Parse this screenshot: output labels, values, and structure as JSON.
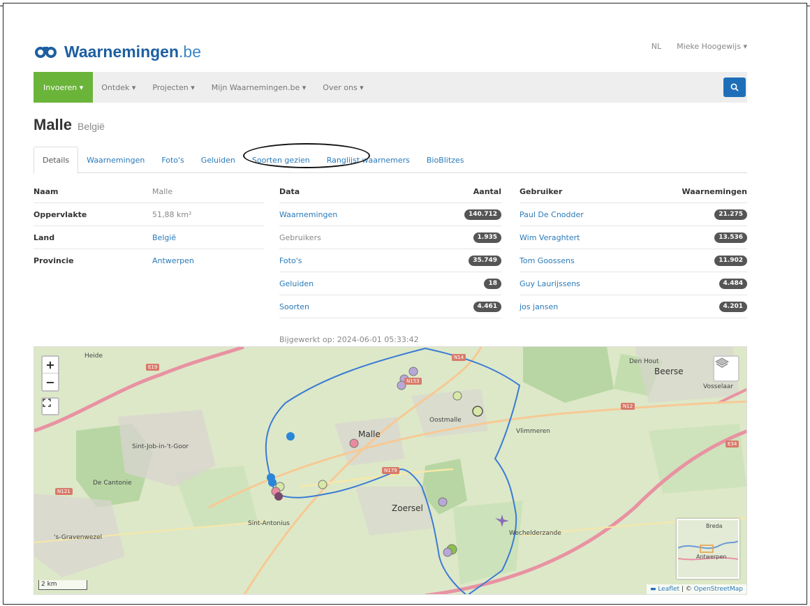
{
  "brand": {
    "name": "Waarnemingen",
    "tld": ".be"
  },
  "header": {
    "language": "NL",
    "user": "Mieke Hoogewijs ▾"
  },
  "nav": {
    "items": [
      "Invoeren ▾",
      "Ontdek ▾",
      "Projecten ▾",
      "Mijn Waarnemingen.be ▾",
      "Over ons ▾"
    ]
  },
  "title": {
    "main": "Malle",
    "sub": "België"
  },
  "tabs": [
    "Details",
    "Waarnemingen",
    "Foto's",
    "Geluiden",
    "Soorten gezien",
    "Ranglijst waarnemers",
    "BioBlitzes"
  ],
  "details": {
    "rows": [
      {
        "label": "Naam",
        "value": "Malle"
      },
      {
        "label": "Oppervlakte",
        "value": "51,88 km²"
      },
      {
        "label": "Land",
        "value": "België"
      },
      {
        "label": "Provincie",
        "value": "Antwerpen"
      }
    ]
  },
  "data_table": {
    "col1": "Data",
    "col2": "Aantal",
    "rows": [
      {
        "label": "Waarnemingen",
        "count": "140.712"
      },
      {
        "label": "Gebruikers",
        "count": "1.935"
      },
      {
        "label": "Foto's",
        "count": "35.749"
      },
      {
        "label": "Geluiden",
        "count": "18"
      },
      {
        "label": "Soorten",
        "count": "4.461"
      }
    ]
  },
  "users_table": {
    "col1": "Gebruiker",
    "col2": "Waarnemingen",
    "rows": [
      {
        "name": "Paul De Cnodder",
        "count": "21.275"
      },
      {
        "name": "Wim Veraghtert",
        "count": "13.536"
      },
      {
        "name": "Tom Goossens",
        "count": "11.902"
      },
      {
        "name": "Guy Laurijssens",
        "count": "4.484"
      },
      {
        "name": "jos jansen",
        "count": "4.201"
      }
    ]
  },
  "updated": "Bijgewerkt op: 2024-06-01 05:33:42",
  "map": {
    "zoom_in": "+",
    "zoom_out": "−",
    "scale": "2 km",
    "attribution_leaflet": "Leaflet",
    "attribution_sep": " | © ",
    "attribution_osm": "OpenStreetMap",
    "labels": {
      "malle": "Malle",
      "zoersel": "Zoersel",
      "beerse": "Beerse",
      "vosselaar": "Vosselaar",
      "oostmalle": "Oostmalle",
      "vlimmeren": "Vlimmeren",
      "sint_job": "Sint-Job-in-'t-Goor",
      "sint_antonius": "Sint-Antonius",
      "s_gravenwezel": "'s-Gravenwezel",
      "den_hout": "Den Hout",
      "wechelderzande": "Wechelderzande",
      "heide": "Heide",
      "de_cantonie": "De Cantonie",
      "mini_breda": "Breda",
      "mini_antwerpen": "Antwerpen"
    },
    "roads": {
      "e19": "E19",
      "n14": "N14",
      "n12": "N12",
      "n179": "N179",
      "n121": "N121",
      "e34": "E34",
      "n153": "N153"
    }
  }
}
